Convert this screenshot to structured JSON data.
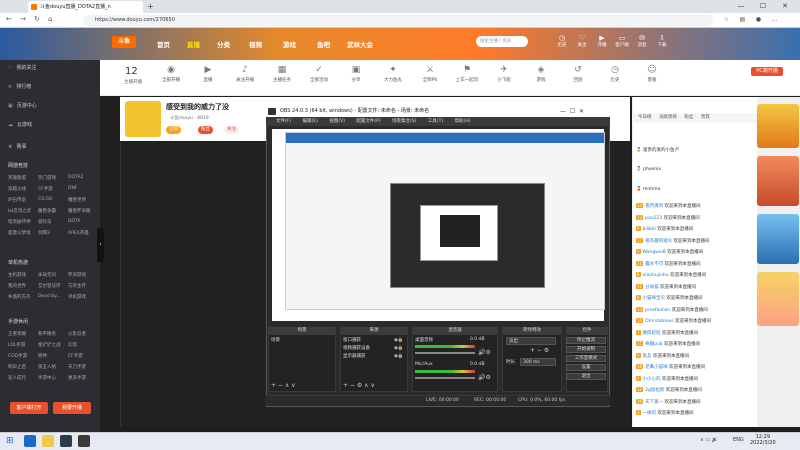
{
  "browser": {
    "tab_title": "斗鱼douyu直播_DOTA2直播_n",
    "new_tab": "+",
    "url": "https://www.douyu.com/270650",
    "win_min": "—",
    "win_max": "☐",
    "win_close": "✕"
  },
  "header": {
    "logo": "斗鱼",
    "nav": [
      "首页",
      "直播",
      "分类",
      "视频",
      "游戏",
      "鱼吧",
      "武林大会"
    ],
    "search_placeholder": "搜索主播 / 房间",
    "icons": [
      "历史",
      "关注",
      "开播",
      "客户端",
      "消息",
      "下载"
    ]
  },
  "sidebar": {
    "items": [
      "我的关注",
      "排行榜",
      "页游中心",
      "云游戏",
      "赛事"
    ],
    "groups": [
      {
        "title": "网游竞技",
        "cells": [
          "英雄联盟",
          "热门游戏",
          "DOTA2",
          "穿越火线",
          "CF手游",
          "DNF",
          "炉石传说",
          "CS:GO",
          "魔兽世界",
          "lol云顶之弈",
          "魔兽争霸",
          "魔兽怀旧服",
          "暗黑破坏神",
          "冒险岛",
          "DOTA",
          "超激斗梦境",
          "剑网3",
          "APEX英雄"
        ]
      },
      {
        "title": "单机热游",
        "cells": [
          "主机游戏",
          "永劫无间",
          "怀旧游戏",
          "我的世界",
          "艾尔登法环",
          "方舟生存",
          "失落的方舟",
          "Dead by...",
          "单机游戏"
        ]
      },
      {
        "title": "手游休闲",
        "cells": [
          "王者荣耀",
          "和平精英",
          "火影忍者",
          "LOL手游",
          "金铲铲之战",
          "幻塔",
          "COD手游",
          "原神",
          "CF手游",
          "明日之后",
          "第五人格",
          "天刀手游",
          "双人成行",
          "手游中心",
          "更多手游"
        ]
      }
    ],
    "btn_client": "客户端打开",
    "btn_live": "我要开播"
  },
  "categories": {
    "follow_count": "12",
    "follow_label": "主播开播",
    "items": [
      "全部开播",
      "直播",
      "关注开播",
      "主播任务",
      "全部活动",
      "分享",
      "大力鱼丸",
      "全网PK",
      "上车一起玩",
      "小飞船",
      "游戏",
      "回放",
      "历史",
      "客服"
    ],
    "pc_btn": "PC端开播"
  },
  "room": {
    "title": "感受到我的威力了没",
    "owner": "斗鱼douyu",
    "room_no": "8819",
    "tag1": "订阅",
    "tag2": "粉丝",
    "tag3": "关注"
  },
  "obs": {
    "title": "OBS 24.0.3 (64 bit, windows) - 配置文件: 未命名 - 场景: 未命名",
    "menu": [
      "文件(F)",
      "编辑(E)",
      "视图(V)",
      "配置文件(P)",
      "场景集合(S)",
      "工具(T)",
      "帮助(H)"
    ],
    "docks": [
      "场景",
      "来源",
      "混音器",
      "转场特效",
      "控件"
    ],
    "scene": "场景",
    "sources": [
      "窗口捕获",
      "视频捕获设备",
      "显示器捕获"
    ],
    "mixer": [
      "桌面音频",
      "Mic/Aux"
    ],
    "mixer_db": [
      "0.0 dB",
      "0.0 dB"
    ],
    "transition": "淡出",
    "duration_label": "时长",
    "duration": "300 ms",
    "controls": [
      "停止推流",
      "开始录制",
      "工作室模式",
      "设置",
      "退出"
    ],
    "status": {
      "live": "LIVE: 00:00:00",
      "rec": "REC: 00:00:00",
      "cpu": "CPU: 0.0%, 60.00 fps"
    }
  },
  "chat": {
    "tabs": [
      "今日榜",
      "贡献周榜",
      "粉丝",
      "贵宾"
    ],
    "rank": [
      "富贵的发的小鱼卢",
      "phoenix",
      "mimma"
    ],
    "lines": [
      {
        "lv": "14",
        "user": "夜月清风",
        "msg": "欢迎来到本直播间"
      },
      {
        "lv": "12",
        "user": "pan123",
        "msg": "欢迎来到本直播间"
      },
      {
        "lv": "9",
        "user": "bilibili",
        "msg": "欢迎来到本直播间"
      },
      {
        "lv": "17",
        "user": "很有趣的观众",
        "msg": "欢迎来到本直播间"
      },
      {
        "lv": "5",
        "user": "Wangwei8",
        "msg": "欢迎来到本直播间"
      },
      {
        "lv": "21",
        "user": "露水不可",
        "msg": "欢迎来到本直播间"
      },
      {
        "lv": "8",
        "user": "xiaohujinhu",
        "msg": "欢迎来到本直播间"
      },
      {
        "lv": "11",
        "user": "分局猫",
        "msg": "欢迎来到本直播间"
      },
      {
        "lv": "6",
        "user": "小猫咪宝贝",
        "msg": "欢迎来到本直播间"
      },
      {
        "lv": "13",
        "user": "proxfanlian",
        "msg": "欢迎来到本直播间"
      },
      {
        "lv": "10",
        "user": "Omndoblues",
        "msg": "欢迎来到本直播间"
      },
      {
        "lv": "7",
        "user": "微风轻轻",
        "msg": "欢迎来到本直播间"
      },
      {
        "lv": "15",
        "user": "奇趣pub",
        "msg": "欢迎来到本直播间"
      },
      {
        "lv": "9",
        "user": "逃兵",
        "msg": "欢迎来到本直播间"
      },
      {
        "lv": "18",
        "user": "老鹰小猫咪",
        "msg": "欢迎来到本直播间"
      },
      {
        "lv": "4",
        "user": "小小心的",
        "msg": "欢迎来到本直播间"
      },
      {
        "lv": "12",
        "user": "2g加拉斯",
        "msg": "欢迎来到本直播间"
      },
      {
        "lv": "16",
        "user": "天下第一",
        "msg": "欢迎来到本直播间"
      },
      {
        "lv": "3",
        "user": "一样的",
        "msg": "欢迎来到本直播间"
      }
    ]
  },
  "taskbar": {
    "time": "12:29",
    "date": "2022/3/20",
    "lang": "ENG"
  }
}
